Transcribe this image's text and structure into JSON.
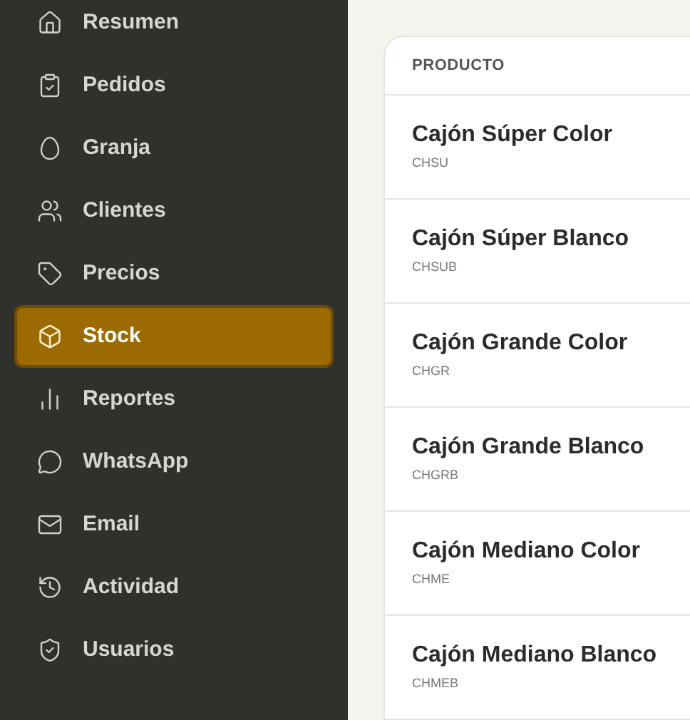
{
  "sidebar": {
    "items": [
      {
        "label": "Resumen",
        "selected": false
      },
      {
        "label": "Pedidos",
        "selected": false
      },
      {
        "label": "Granja",
        "selected": false
      },
      {
        "label": "Clientes",
        "selected": false
      },
      {
        "label": "Precios",
        "selected": false
      },
      {
        "label": "Stock",
        "selected": true
      },
      {
        "label": "Reportes",
        "selected": false
      },
      {
        "label": "WhatsApp",
        "selected": false
      },
      {
        "label": "Email",
        "selected": false
      },
      {
        "label": "Actividad",
        "selected": false
      },
      {
        "label": "Usuarios",
        "selected": false
      }
    ]
  },
  "table": {
    "columns": [
      "PRODUCTO"
    ],
    "rows": [
      {
        "name": "Cajón Súper Color",
        "code": "CHSU"
      },
      {
        "name": "Cajón Súper Blanco",
        "code": "CHSUB"
      },
      {
        "name": "Cajón Grande Color",
        "code": "CHGR"
      },
      {
        "name": "Cajón Grande Blanco",
        "code": "CHGRB"
      },
      {
        "name": "Cajón Mediano Color",
        "code": "CHME"
      },
      {
        "name": "Cajón Mediano Blanco",
        "code": "CHMEB"
      }
    ]
  }
}
